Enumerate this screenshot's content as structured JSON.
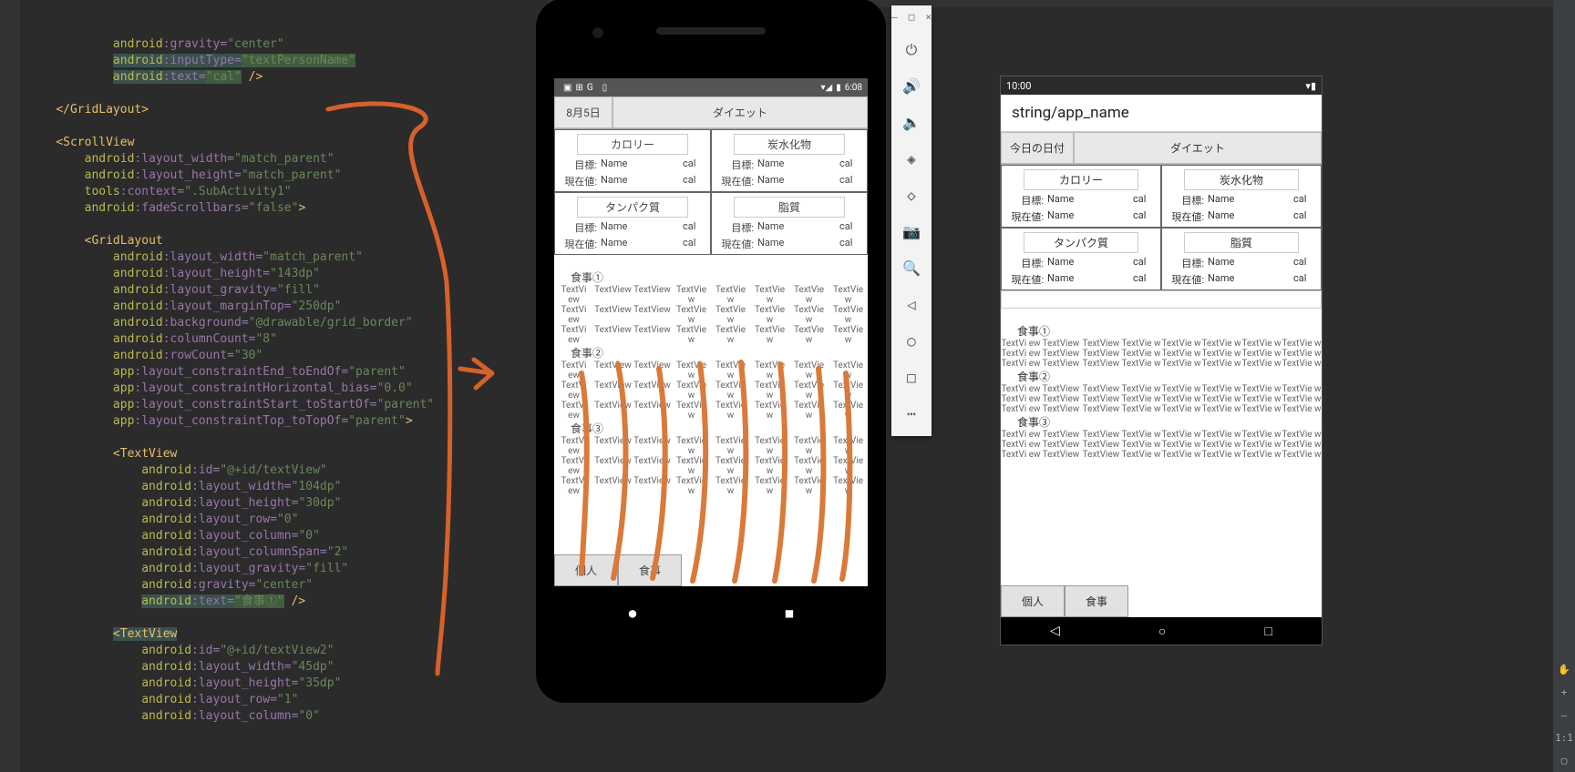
{
  "code": {
    "l1a": "android",
    "l1b": ":gravity=",
    "l1v": "\"center\"",
    "l2a": "android",
    "l2b": ":inputType=",
    "l2v": "\"textPersonName\"",
    "l3a": "android",
    "l3b": ":text=",
    "l3v": "\"cal\"",
    "l3end": " />",
    "l5": "</",
    "l5t": "GridLayout",
    "l5e": ">",
    "l7": "<",
    "l7t": "ScrollView",
    "l8a": "android",
    "l8b": ":layout_width=",
    "l8v": "\"match_parent\"",
    "l9a": "android",
    "l9b": ":layout_height=",
    "l9v": "\"match_parent\"",
    "l10a": "tools",
    "l10b": ":context=",
    "l10v": "\".SubActivity1\"",
    "l11a": "android",
    "l11b": ":fadeScrollbars=",
    "l11v": "\"false\"",
    "l11e": ">",
    "l13": "<",
    "l13t": "GridLayout",
    "l14a": "android",
    "l14b": ":layout_width=",
    "l14v": "\"match_parent\"",
    "l15a": "android",
    "l15b": ":layout_height=",
    "l15v": "\"143dp\"",
    "l16a": "android",
    "l16b": ":layout_gravity=",
    "l16v": "\"fill\"",
    "l17a": "android",
    "l17b": ":layout_marginTop=",
    "l17v": "\"250dp\"",
    "l18a": "android",
    "l18b": ":background=",
    "l18v": "\"@drawable/grid_border\"",
    "l19a": "android",
    "l19b": ":columnCount=",
    "l19v": "\"8\"",
    "l20a": "android",
    "l20b": ":rowCount=",
    "l20v": "\"30\"",
    "l21a": "app",
    "l21b": ":layout_constraintEnd_toEndOf=",
    "l21v": "\"parent\"",
    "l22a": "app",
    "l22b": ":layout_constraintHorizontal_bias=",
    "l22v": "\"0.0\"",
    "l23a": "app",
    "l23b": ":layout_constraintStart_toStartOf=",
    "l23v": "\"parent\"",
    "l24a": "app",
    "l24b": ":layout_constraintTop_toTopOf=",
    "l24v": "\"parent\"",
    "l24e": ">",
    "l26": "<",
    "l26t": "TextView",
    "l27a": "android",
    "l27b": ":id=",
    "l27v": "\"@+id/textView\"",
    "l28a": "android",
    "l28b": ":layout_width=",
    "l28v": "\"104dp\"",
    "l29a": "android",
    "l29b": ":layout_height=",
    "l29v": "\"30dp\"",
    "l30a": "android",
    "l30b": ":layout_row=",
    "l30v": "\"0\"",
    "l31a": "android",
    "l31b": ":layout_column=",
    "l31v": "\"0\"",
    "l32a": "android",
    "l32b": ":layout_columnSpan=",
    "l32v": "\"2\"",
    "l33a": "android",
    "l33b": ":layout_gravity=",
    "l33v": "\"fill\"",
    "l34a": "android",
    "l34b": ":gravity=",
    "l34v": "\"center\"",
    "l35a": "android",
    "l35b": ":text=",
    "l35v": "\"食事①\"",
    "l35e": " />",
    "l37": "<",
    "l37t": "TextView",
    "l38a": "android",
    "l38b": ":id=",
    "l38v": "\"@+id/textView2\"",
    "l39a": "android",
    "l39b": ":layout_width=",
    "l39v": "\"45dp\"",
    "l40a": "android",
    "l40b": ":layout_height=",
    "l40v": "\"35dp\"",
    "l41a": "android",
    "l41b": ":layout_row=",
    "l41v": "\"1\"",
    "l42a": "android",
    "l42b": ":layout_column=",
    "l42v": "\"0\""
  },
  "emu": {
    "status_time": "6:08",
    "tab_date": "8月5日",
    "tab_title": "ダイエット",
    "nut_boxes": [
      {
        "t": "カロリー",
        "target": "目標:",
        "now": "現在値:",
        "name": "Name",
        "unit": "cal"
      },
      {
        "t": "炭水化物",
        "target": "目標:",
        "now": "現在値:",
        "name": "Name",
        "unit": "cal"
      },
      {
        "t": "タンパク質",
        "target": "目標:",
        "now": "現在値:",
        "name": "Name",
        "unit": "cal"
      },
      {
        "t": "脂質",
        "target": "目標:",
        "now": "現在値:",
        "name": "Name",
        "unit": "cal"
      }
    ],
    "meals": [
      "食事①",
      "食事②",
      "食事③"
    ],
    "cells": [
      "TextVi\new",
      "TextView",
      "TextView",
      "TextVie\nw",
      "TextVie\nw",
      "TextVie\nw",
      "TextVie\nw",
      "TextVie\nw"
    ],
    "bottom": [
      "個人",
      "食事"
    ]
  },
  "emu_ctrl": {
    "win": [
      "–",
      "□",
      "×"
    ],
    "icons": [
      "⏻",
      "🔊",
      "🔈",
      "◈",
      "◇",
      "📷",
      "🔍",
      "◁",
      "○",
      "□",
      "⋯"
    ]
  },
  "preview": {
    "status_time": "10:00",
    "appbar": "string/app_name",
    "tab_date": "今日の日付",
    "tab_title": "ダイエット",
    "nut_boxes": [
      {
        "t": "カロリー",
        "target": "目標:",
        "now": "現在値:",
        "name": "Name",
        "unit": "cal"
      },
      {
        "t": "炭水化物",
        "target": "目標:",
        "now": "現在値:",
        "name": "Name",
        "unit": "cal"
      },
      {
        "t": "タンパク質",
        "target": "目標:",
        "now": "現在値:",
        "name": "Name",
        "unit": "cal"
      },
      {
        "t": "脂質",
        "target": "目標:",
        "now": "現在値:",
        "name": "Name",
        "unit": "cal"
      }
    ],
    "meals": [
      "食事①",
      "食事②",
      "食事③"
    ],
    "cells": [
      "TextVi\new",
      "TextView",
      "TextView",
      "TextVie\nw",
      "TextVie\nw",
      "TextVie\nw",
      "TextVie\nw",
      "TextVie\nw"
    ],
    "bottom": [
      "個人",
      "食事"
    ]
  },
  "rail": {
    "zoom": "1:1",
    "plus": "+",
    "minus": "–",
    "pan": "✋",
    "sq": "▢"
  }
}
